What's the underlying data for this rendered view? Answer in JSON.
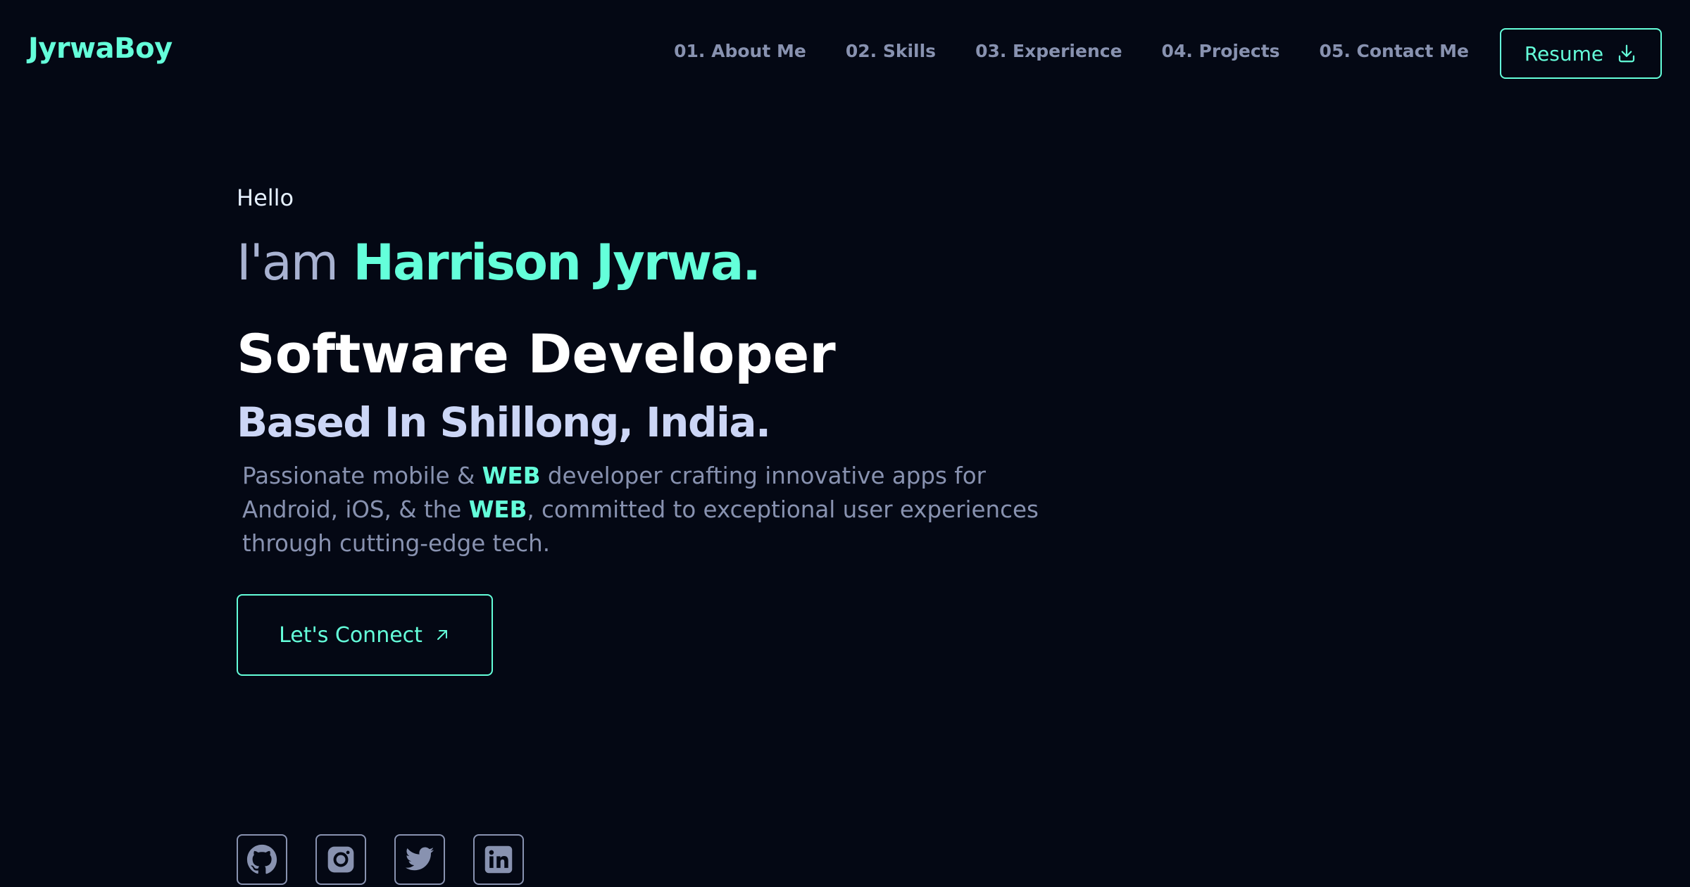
{
  "brand": {
    "logo": "JyrwaBoy"
  },
  "nav": {
    "items": [
      {
        "label": "01. About Me"
      },
      {
        "label": "02. Skills"
      },
      {
        "label": "03. Experience"
      },
      {
        "label": "04. Projects"
      },
      {
        "label": "05. Contact Me"
      }
    ],
    "resume_label": "Resume",
    "resume_icon": "download-icon"
  },
  "hero": {
    "greeting": "Hello",
    "iam_prefix": "I'am",
    "name": "Harrison Jyrwa.",
    "role": "Software Developer",
    "based_prefix": "Based In Shillong,",
    "country": "India.",
    "desc": {
      "p1": "Passionate mobile & ",
      "web1": "WEB",
      "p2": " developer crafting innovative apps for Android, iOS, & the ",
      "web2": "WEB",
      "p3": ", committed to exceptional user experiences through cutting-edge tech."
    },
    "cta_label": "Let's Connect",
    "cta_icon": "arrow-up-right-icon"
  },
  "socials": [
    {
      "name": "github",
      "icon": "github-icon"
    },
    {
      "name": "instagram",
      "icon": "instagram-icon"
    },
    {
      "name": "twitter",
      "icon": "twitter-icon"
    },
    {
      "name": "linkedin",
      "icon": "linkedin-icon"
    }
  ],
  "colors": {
    "background": "#040814",
    "accent": "#64ffda",
    "muted": "#8892b0",
    "light": "#ccd6f6",
    "white": "#ffffff"
  }
}
